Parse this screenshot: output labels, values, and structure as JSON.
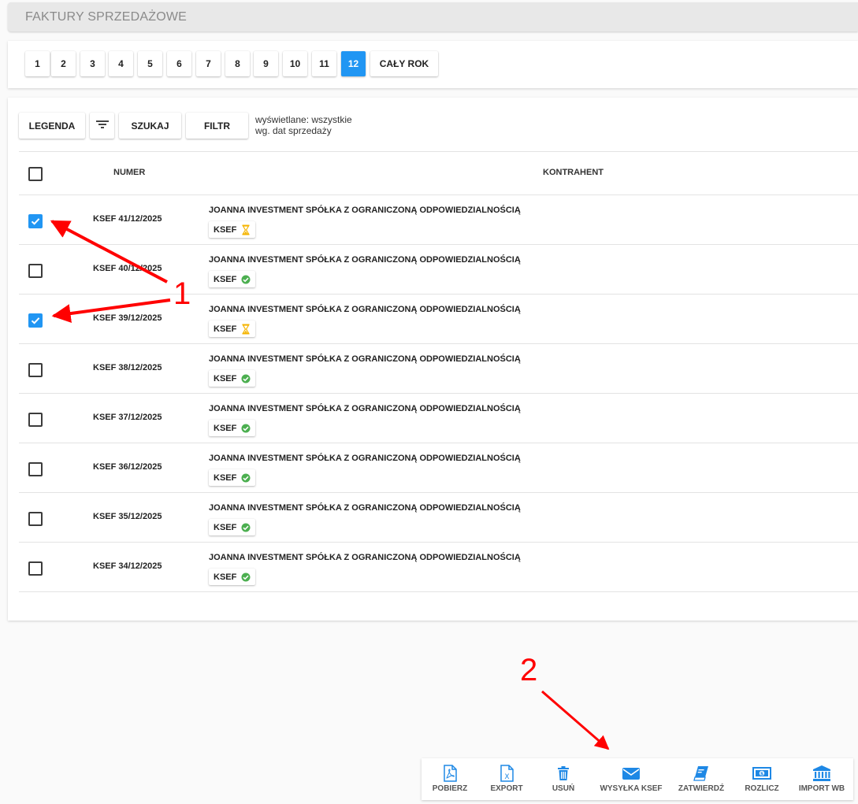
{
  "page": {
    "title": "FAKTURY SPRZEDAŻOWE"
  },
  "months": [
    "1",
    "2",
    "3",
    "4",
    "5",
    "6",
    "7",
    "8",
    "9",
    "10",
    "11",
    "12"
  ],
  "active_month": "12",
  "year_button": "CAŁY ROK",
  "toolbar": {
    "legend": "LEGENDA",
    "filter_icon": "filter-list-icon",
    "search": "SZUKAJ",
    "filter": "FILTR",
    "info_line1": "wyświetlane: wszystkie",
    "info_line2": "wg. dat sprzedaży"
  },
  "table": {
    "col_number": "NUMER",
    "col_contractor": "KONTRAHENT",
    "rows": [
      {
        "number": "KSEF 41/12/2025",
        "contractor": "JOANNA INVESTMENT SPÓŁKA Z OGRANICZONĄ ODPOWIEDZIALNOŚCIĄ",
        "badge": "KSEF",
        "status": "pending",
        "checked": true
      },
      {
        "number": "KSEF 40/12/2025",
        "contractor": "JOANNA INVESTMENT SPÓŁKA Z OGRANICZONĄ ODPOWIEDZIALNOŚCIĄ",
        "badge": "KSEF",
        "status": "ok",
        "checked": false
      },
      {
        "number": "KSEF 39/12/2025",
        "contractor": "JOANNA INVESTMENT SPÓŁKA Z OGRANICZONĄ ODPOWIEDZIALNOŚCIĄ",
        "badge": "KSEF",
        "status": "pending",
        "checked": true
      },
      {
        "number": "KSEF 38/12/2025",
        "contractor": "JOANNA INVESTMENT SPÓŁKA Z OGRANICZONĄ ODPOWIEDZIALNOŚCIĄ",
        "badge": "KSEF",
        "status": "ok",
        "checked": false
      },
      {
        "number": "KSEF 37/12/2025",
        "contractor": "JOANNA INVESTMENT SPÓŁKA Z OGRANICZONĄ ODPOWIEDZIALNOŚCIĄ",
        "badge": "KSEF",
        "status": "ok",
        "checked": false
      },
      {
        "number": "KSEF 36/12/2025",
        "contractor": "JOANNA INVESTMENT SPÓŁKA Z OGRANICZONĄ ODPOWIEDZIALNOŚCIĄ",
        "badge": "KSEF",
        "status": "ok",
        "checked": false
      },
      {
        "number": "KSEF 35/12/2025",
        "contractor": "JOANNA INVESTMENT SPÓŁKA Z OGRANICZONĄ ODPOWIEDZIALNOŚCIĄ",
        "badge": "KSEF",
        "status": "ok",
        "checked": false
      },
      {
        "number": "KSEF 34/12/2025",
        "contractor": "JOANNA INVESTMENT SPÓŁKA Z OGRANICZONĄ ODPOWIEDZIALNOŚCIĄ",
        "badge": "KSEF",
        "status": "ok",
        "checked": false
      }
    ]
  },
  "actions": [
    {
      "label": "POBIERZ",
      "icon": "pdf-file-icon"
    },
    {
      "label": "EXPORT",
      "icon": "excel-file-icon"
    },
    {
      "label": "USUŃ",
      "icon": "trash-icon"
    },
    {
      "label": "WYSYŁKA KSEF",
      "icon": "envelope-icon"
    },
    {
      "label": "ZATWIERDŹ",
      "icon": "book-icon"
    },
    {
      "label": "ROZLICZ",
      "icon": "money-bill-icon"
    },
    {
      "label": "IMPORT WB",
      "icon": "bank-icon"
    }
  ],
  "annotations": {
    "marker1": "1",
    "marker2": "2"
  },
  "colors": {
    "accent": "#2196f3",
    "ok": "#4caf50",
    "pending": "#f5b400",
    "annotation": "#ff0000"
  }
}
